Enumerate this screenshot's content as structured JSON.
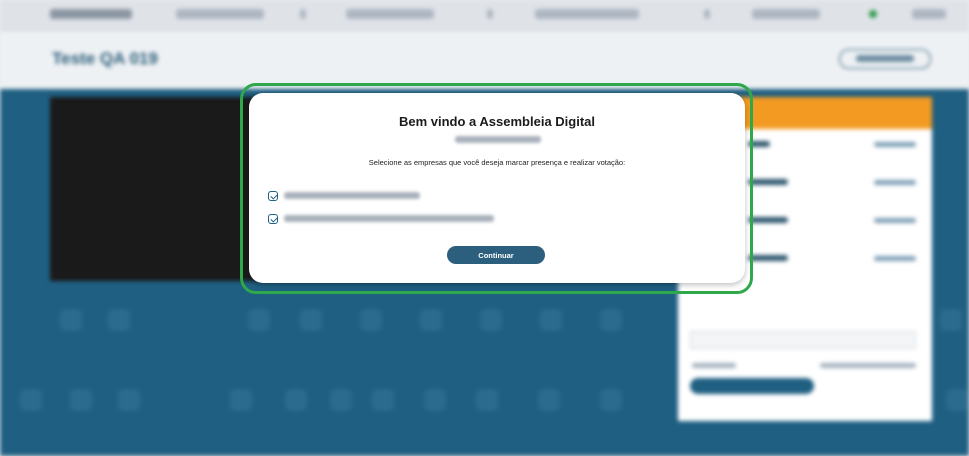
{
  "app": {
    "page_title": "Teste QA 019"
  },
  "modal": {
    "title": "Bem vindo a Assembleia Digital",
    "instruction": "Selecione as empresas que você deseja marcar presença e realizar votação:",
    "companies": [
      {
        "checked": true
      },
      {
        "checked": true
      }
    ],
    "continue_label": "Continuar"
  },
  "colors": {
    "brand_teal": "#1f5f82",
    "accent_orange": "#f29a22",
    "highlight_green": "#2ea84a",
    "button_dark": "#2c5f7e"
  },
  "icons": {
    "checkbox": "checkbox-checked-icon"
  }
}
